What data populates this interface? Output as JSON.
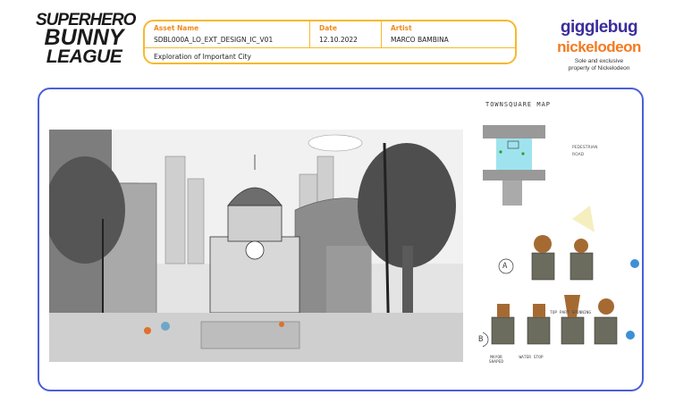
{
  "logo": {
    "line1": "SUPERHERO",
    "line2": "BUNNY",
    "line3": "LEAGUE"
  },
  "info": {
    "asset_label": "Asset Name",
    "asset_value": "SDBL000A_LO_EXT_DESIGN_IC_V01",
    "date_label": "Date",
    "date_value": "12.10.2022",
    "artist_label": "Artist",
    "artist_value": "MARCO BAMBINA",
    "description": "Exploration of Important City"
  },
  "brand": {
    "gigglebug": "gigglebug",
    "nickelodeon": "nickelodeon",
    "note1": "Sole and exclusive",
    "note2": "property of Nickelodeon"
  },
  "sketches": {
    "map_title": "TOWNSQUARE MAP",
    "legend_pedestrian": "PEDESTRIAN",
    "legend_road": "ROAD",
    "label_a": "A",
    "label_b": "B",
    "top_part": "TOP PART SPINNING",
    "mayor": "MAYOR SHAPED",
    "water": "WATER STOP"
  },
  "colors": {
    "accent_orange": "#f6b92c",
    "frame_blue": "#4a5fd8",
    "pedestrian": "#9fe3ef"
  }
}
